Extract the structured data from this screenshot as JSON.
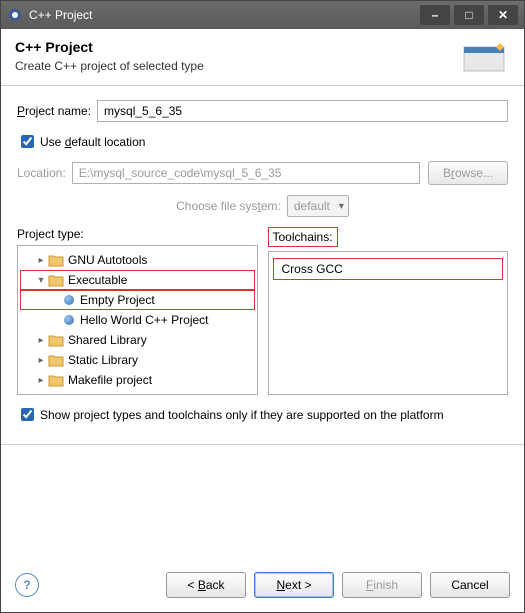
{
  "window": {
    "title": "C++ Project"
  },
  "banner": {
    "heading": "C++ Project",
    "sub": "Create C++ project of selected type"
  },
  "form": {
    "project_name_label": "Project name:",
    "project_name_value": "mysql_5_6_35",
    "use_default_label": "Use default location",
    "use_default_checked": true,
    "location_label": "Location:",
    "location_value": "E:\\mysql_source_code\\mysql_5_6_35",
    "browse": "Browse...",
    "fs_label": "Choose file system:",
    "fs_value": "default"
  },
  "columns": {
    "left_label": "Project type:",
    "right_label": "Toolchains:",
    "tree": [
      {
        "label": "GNU Autotools",
        "expanded": false,
        "level": 1,
        "type": "folder"
      },
      {
        "label": "Executable",
        "expanded": true,
        "level": 1,
        "type": "folder",
        "highlight": true
      },
      {
        "label": "Empty Project",
        "level": 2,
        "type": "leaf",
        "highlight": true
      },
      {
        "label": "Hello World C++ Project",
        "level": 2,
        "type": "leaf"
      },
      {
        "label": "Shared Library",
        "expanded": false,
        "level": 1,
        "type": "folder"
      },
      {
        "label": "Static Library",
        "expanded": false,
        "level": 1,
        "type": "folder"
      },
      {
        "label": "Makefile project",
        "expanded": false,
        "level": 1,
        "type": "folder"
      }
    ],
    "toolchains": [
      {
        "label": "Cross GCC",
        "highlight": true
      }
    ]
  },
  "support_label": "Show project types and toolchains only if they are supported on the platform",
  "support_checked": true,
  "footer": {
    "back": "< Back",
    "next": "Next >",
    "finish": "Finish",
    "cancel": "Cancel"
  }
}
